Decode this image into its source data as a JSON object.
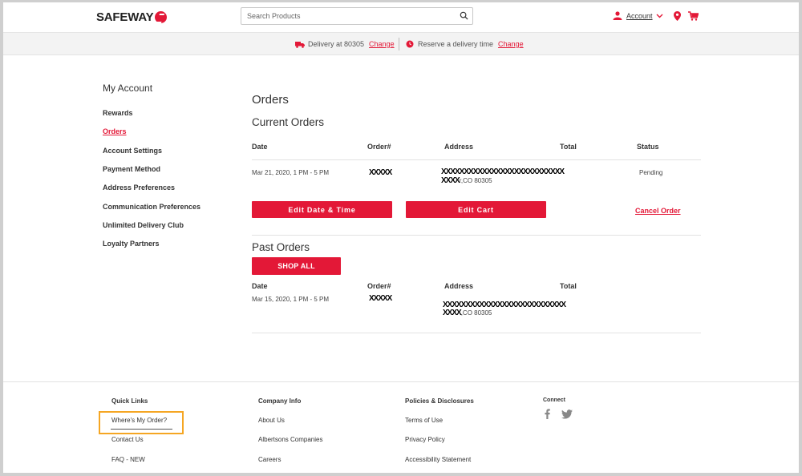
{
  "header": {
    "logo": "SAFEWAY",
    "search_placeholder": "Search Products",
    "account_label": "Account"
  },
  "delivery_bar": {
    "delivery_text": "Delivery at 80305",
    "delivery_change": "Change",
    "reserve_text": "Reserve a delivery time",
    "reserve_change": "Change"
  },
  "sidebar": {
    "title": "My Account",
    "items": [
      {
        "label": "Rewards"
      },
      {
        "label": "Orders"
      },
      {
        "label": "Account Settings"
      },
      {
        "label": "Payment Method"
      },
      {
        "label": "Address Preferences"
      },
      {
        "label": "Communication Preferences"
      },
      {
        "label": "Unlimited Delivery Club"
      },
      {
        "label": "Loyalty Partners"
      }
    ],
    "active_item": "Orders"
  },
  "main": {
    "title": "Orders",
    "current": {
      "heading": "Current Orders",
      "columns": [
        "Date",
        "Order#",
        "Address",
        "Total",
        "Status"
      ],
      "row": {
        "date": "Mar 21, 2020, 1 PM - 5 PM",
        "order": "XXXXX",
        "address_line1": "XXXXXXXXXXXXXXXXXXXXXXXXXXX",
        "address_line2_redact": "XXXX",
        "address_line2_rest": "r,CO 80305",
        "total": "",
        "status": "Pending"
      },
      "edit_date_button": "Edit Date & Time",
      "edit_cart_button": "Edit Cart",
      "cancel_link": "Cancel Order"
    },
    "past": {
      "heading": "Past Orders",
      "shop_all_button": "SHOP ALL",
      "columns": [
        "Date",
        "Order#",
        "Address",
        "Total"
      ],
      "row": {
        "date": "Mar 15, 2020, 1 PM - 5 PM",
        "order": "XXXXX",
        "address_line1": "XXXXXXXXXXXXXXXXXXXXXXXXXXX",
        "address_line2_redact": "XXXX",
        "address_line2_rest": ",CO 80305"
      }
    }
  },
  "footer": {
    "quick_links": {
      "heading": "Quick Links",
      "items": [
        "Where's My Order?",
        "Contact Us",
        "FAQ - NEW"
      ]
    },
    "company_info": {
      "heading": "Company Info",
      "items": [
        "About Us",
        "Albertsons Companies",
        "Careers"
      ]
    },
    "policies": {
      "heading": "Policies & Disclosures",
      "items": [
        "Terms of Use",
        "Privacy Policy",
        "Accessibility Statement"
      ]
    },
    "connect": {
      "heading": "Connect"
    }
  },
  "colors": {
    "accent": "#e31837",
    "highlight": "#f5a623"
  }
}
